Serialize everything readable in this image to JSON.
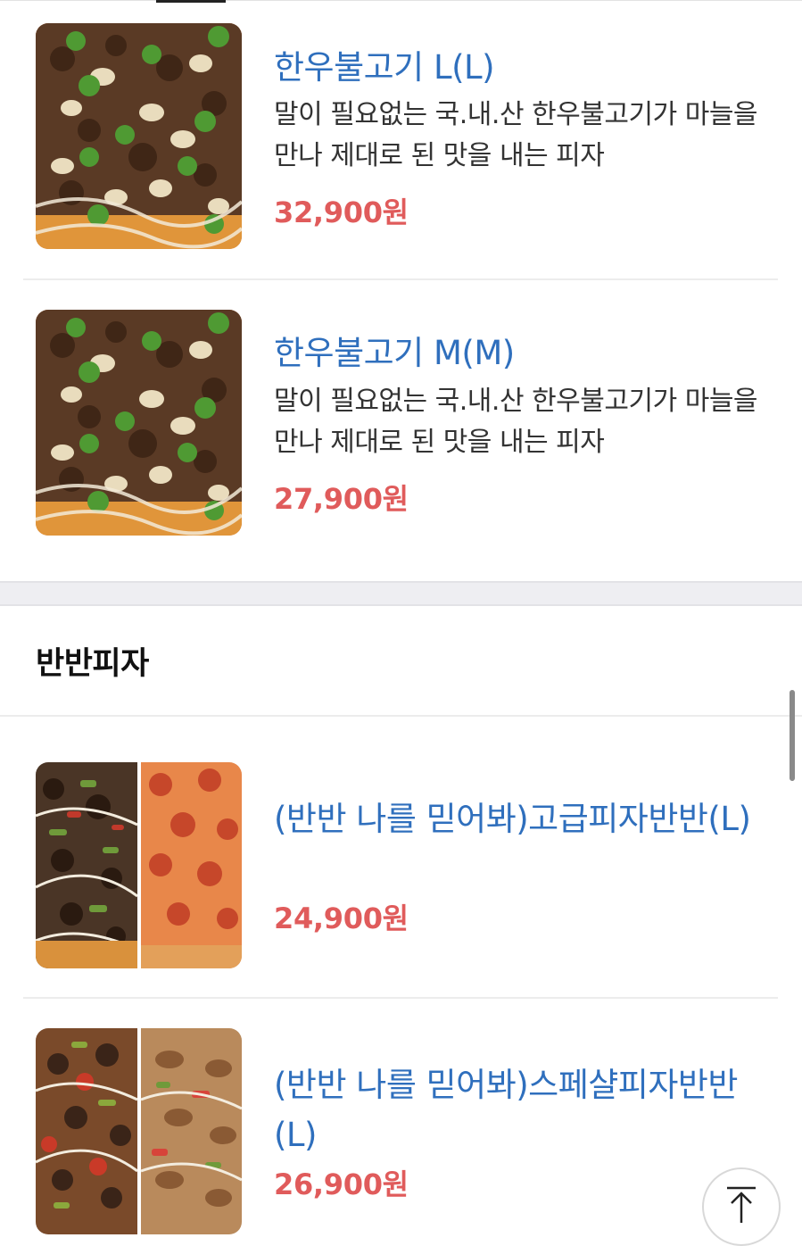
{
  "sections": [
    {
      "title": "",
      "items": [
        {
          "name": "한우불고기 L(L)",
          "description": "말이 필요없는 국.내.산 한우불고기가 마늘을 만나 제대로 된 맛을 내는 피자",
          "price": "32,900원",
          "image": "bulgogi-pizza-image"
        },
        {
          "name": "한우불고기 M(M)",
          "description": "말이 필요없는 국.내.산 한우불고기가 마늘을 만나 제대로 된 맛을 내는 피자",
          "price": "27,900원",
          "image": "bulgogi-pizza-image"
        }
      ]
    },
    {
      "title": "반반피자",
      "items": [
        {
          "name": "(반반 나를 믿어봐)고급피자반반(L)",
          "price": "24,900원",
          "image": "half-half-pizza-image"
        },
        {
          "name": "(반반 나를 믿어봐)스페샬피자반반(L)",
          "price": "26,900원",
          "image": "half-half-pizza-image"
        }
      ]
    }
  ],
  "controls": {
    "scroll_top_icon": "arrow-up-to-top-icon"
  },
  "colors": {
    "title": "#2f6fbd",
    "price": "#e05b5b",
    "section_gap": "#eeeef2"
  }
}
